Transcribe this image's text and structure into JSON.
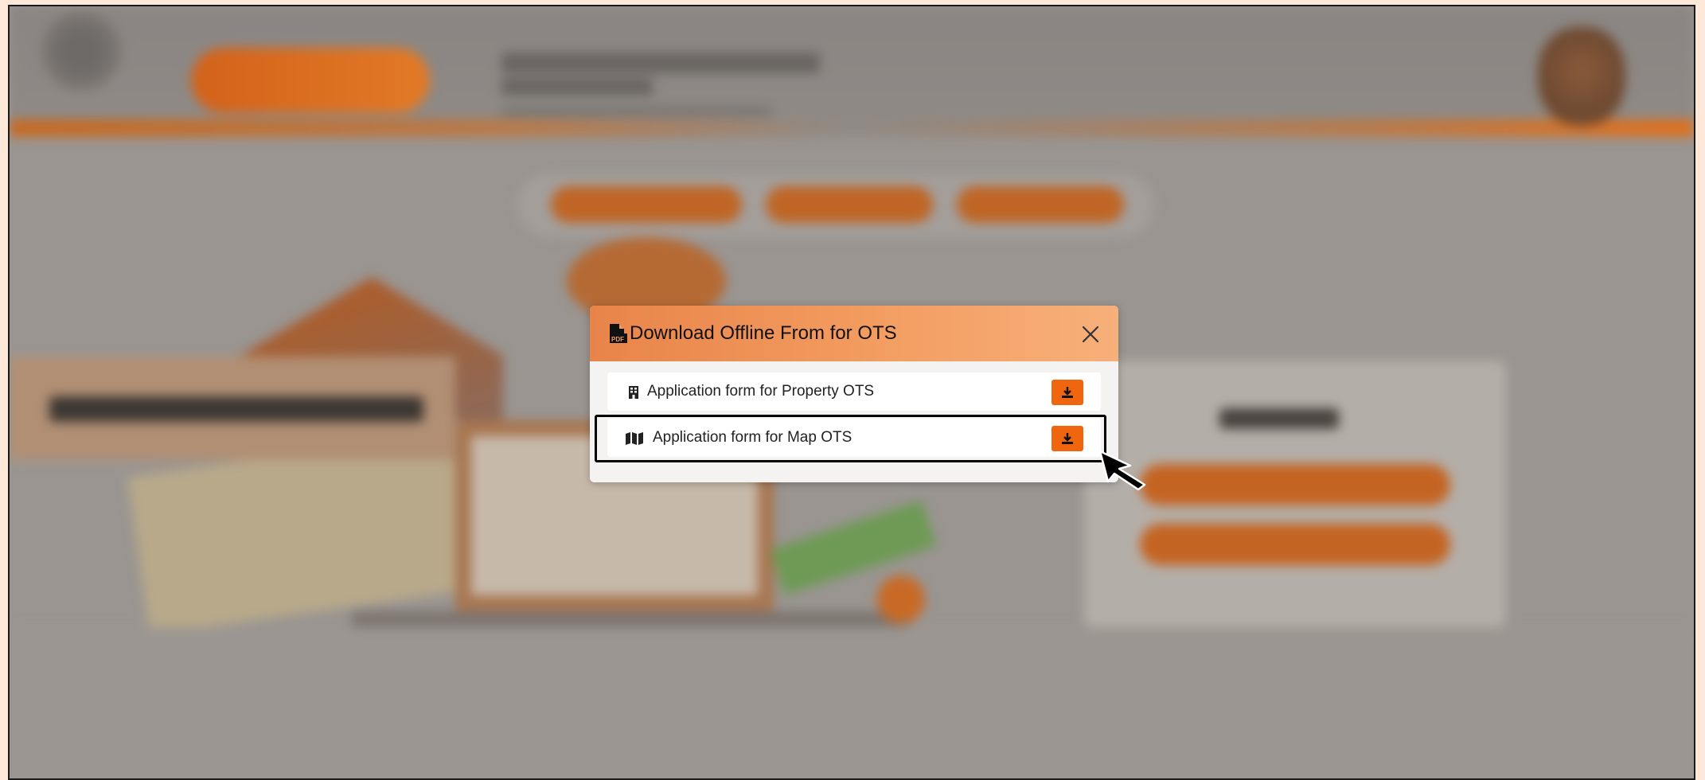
{
  "modal": {
    "title": "Download Offline From for OTS",
    "title_icon": "pdf-file-icon",
    "close_icon": "close-icon",
    "items": [
      {
        "label": "Application form for Property OTS",
        "icon": "building-icon",
        "action_icon": "download-icon"
      },
      {
        "label": "Application form for Map OTS",
        "icon": "map-icon",
        "action_icon": "download-icon"
      }
    ],
    "highlighted_item_index": 1
  },
  "colors": {
    "modal_header_start": "#e8844a",
    "modal_header_end": "#f7b07a",
    "download_button": "#f0660f",
    "highlight_border": "#000000",
    "page_border": "#fde8da"
  }
}
